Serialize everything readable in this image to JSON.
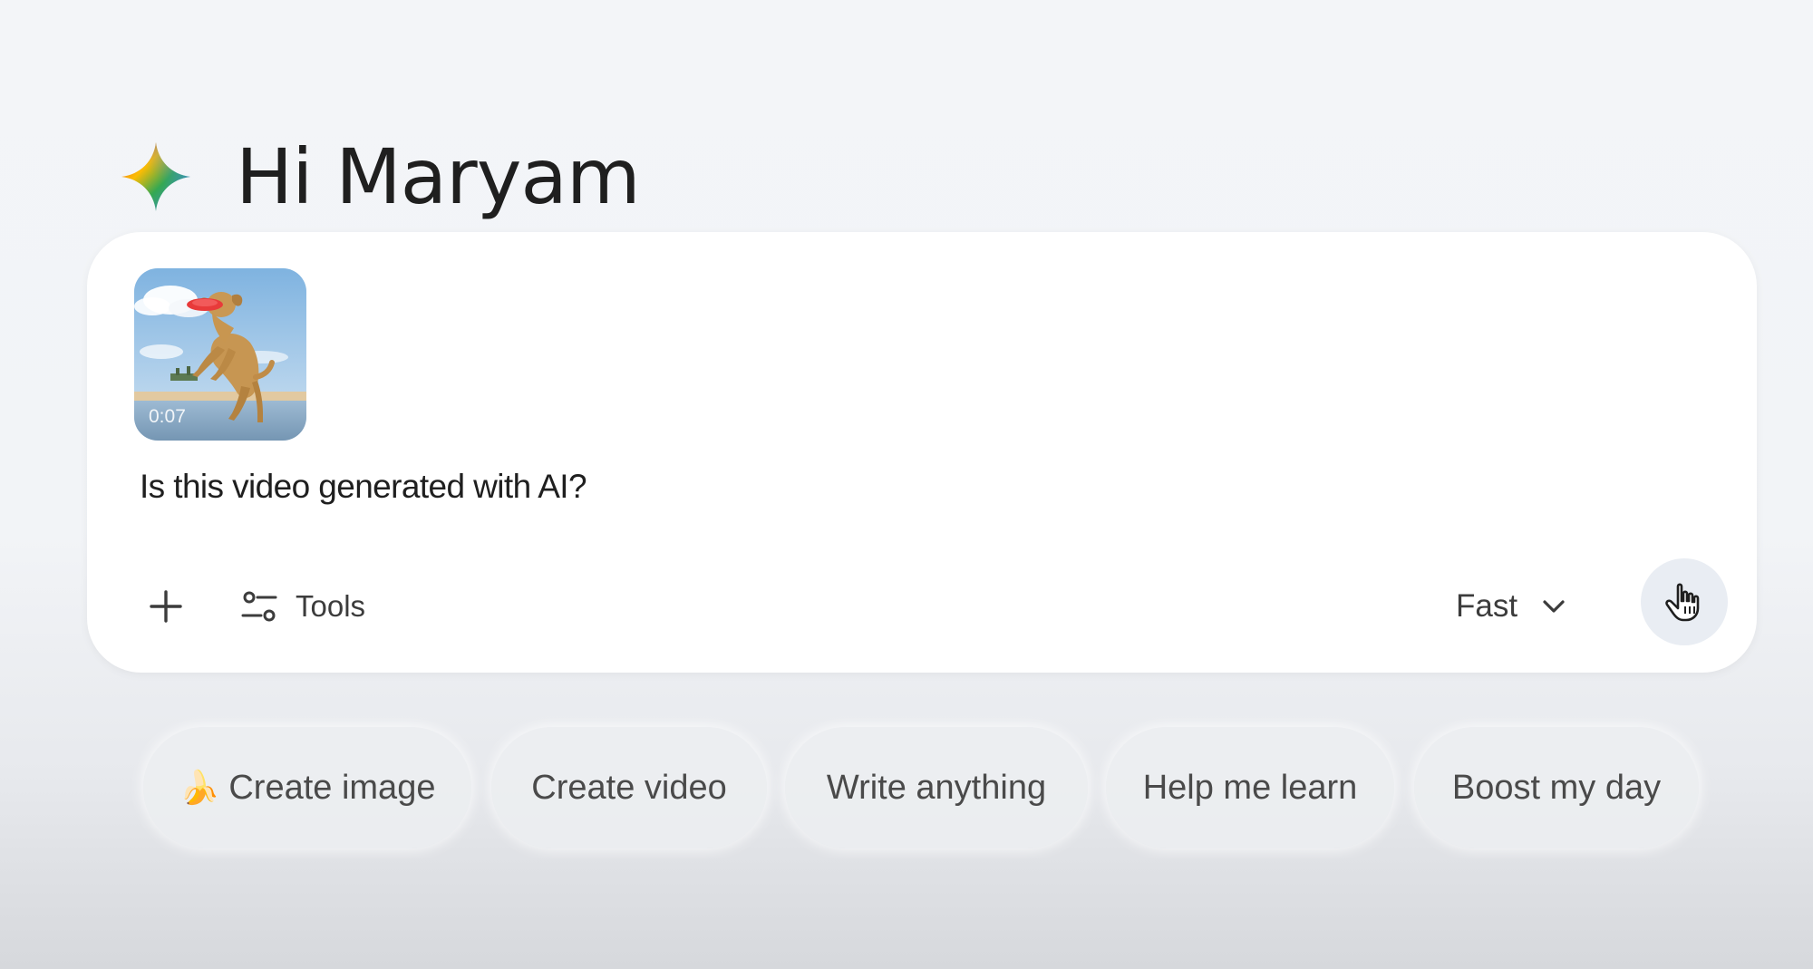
{
  "greeting": {
    "text": "Hi Maryam",
    "icon": "gemini-spark-icon"
  },
  "prompt": {
    "attachment": {
      "type": "video",
      "duration": "0:07",
      "description_icon": "video-thumbnail"
    },
    "text": "Is this video generated with AI?",
    "add_icon": "plus-icon",
    "tools_icon": "sliders-icon",
    "tools_label": "Tools",
    "model": "Fast",
    "model_icon": "chevron-down-icon",
    "send_icon": "hand-cursor-icon"
  },
  "suggestions": [
    {
      "emoji": "🍌",
      "label": "Create image"
    },
    {
      "emoji": "",
      "label": "Create video"
    },
    {
      "emoji": "",
      "label": "Write anything"
    },
    {
      "emoji": "",
      "label": "Help me learn"
    },
    {
      "emoji": "",
      "label": "Boost my day"
    }
  ],
  "colors": {
    "background": "#f2f4f7",
    "card": "#ffffff",
    "text": "#1f1f1f",
    "chip": "#eceef1",
    "send_button": "#e9edf3"
  }
}
